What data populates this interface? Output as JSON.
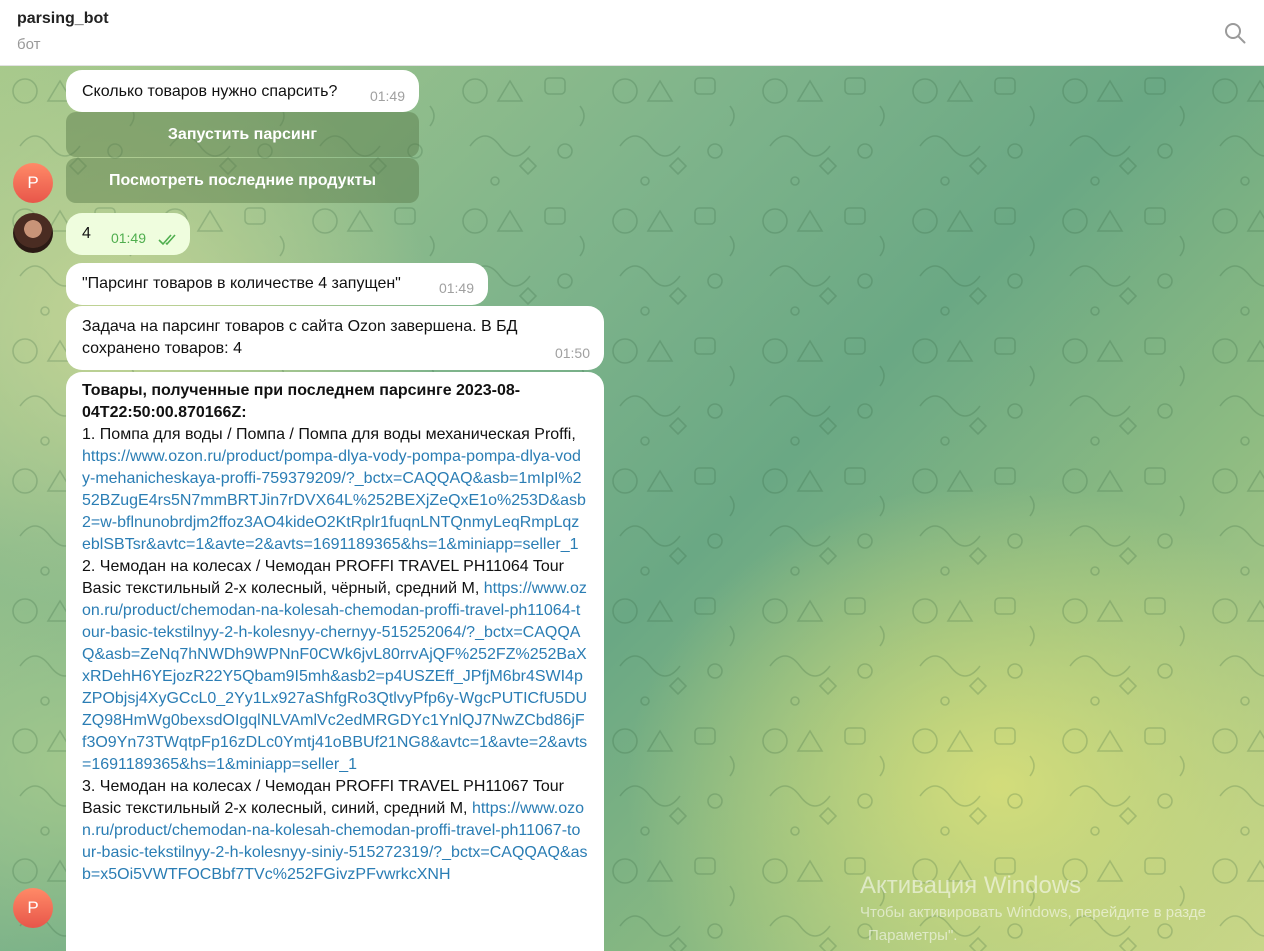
{
  "header": {
    "title": "parsing_bot",
    "subtitle": "бот"
  },
  "messages": {
    "m1": {
      "text": "Сколько товаров нужно спарсить?",
      "time": "01:49"
    },
    "m2": {
      "text": "4",
      "time": "01:49"
    },
    "m3": {
      "text": "\"Парсинг товаров в количестве 4 запущен\"",
      "time": "01:49"
    },
    "m4": {
      "text": "Задача на парсинг товаров с сайта Ozon завершена. В БД сохранено товаров: 4",
      "time": "01:50"
    }
  },
  "keyboard": {
    "btn1": "Запустить парсинг",
    "btn2": "Посмотреть последние продукты"
  },
  "avatar": {
    "bot_letter": "P"
  },
  "products": {
    "heading": "Товары, полученные при последнем парсинге 2023-08-04T22:50:00.870166Z:",
    "items": [
      {
        "title": "1. Помпа для воды / Помпа / Помпа для воды механическая Proffi,",
        "url": "https://www.ozon.ru/product/pompa-dlya-vody-pompa-pompa-dlya-vody-mehanicheskaya-proffi-759379209/?_bctx=CAQQAQ&asb=1mIpI%252BZugE4rs5N7mmBRTJin7rDVX64L%252BEXjZeQxE1o%253D&asb2=w-bflnunobrdjm2ffoz3AO4kideO2KtRplr1fuqnLNTQnmyLeqRmpLqzeblSBTsr&avtc=1&avte=2&avts=1691189365&hs=1&miniapp=seller_1"
      },
      {
        "title": "2. Чемодан на колесах / Чемодан PROFFI TRAVEL PH11064 Tour Basic текстильный 2-х колесный, чёрный, средний M,",
        "url": "https://www.ozon.ru/product/chemodan-na-kolesah-chemodan-proffi-travel-ph11064-tour-basic-tekstilnyy-2-h-kolesnyy-chernyy-515252064/?_bctx=CAQQAQ&asb=ZeNq7hNWDh9WPNnF0CWk6jvL80rrvAjQF%252FZ%252BaXxRDehH6YEjozR22Y5Qbam9I5mh&asb2=p4USZEff_JPfjM6br4SWI4pZPObjsj4XyGCcL0_2Yy1Lx927aShfgRo3QtlvyPfp6y-WgcPUTICfU5DUZQ98HmWg0bexsdOIgqlNLVAmlVc2edMRGDYc1YnlQJ7NwZCbd86jFf3O9Yn73TWqtpFp16zDLc0Ymtj41oBBUf21NG8&avtc=1&avte=2&avts=1691189365&hs=1&miniapp=seller_1"
      },
      {
        "title": "3. Чемодан на колесах / Чемодан PROFFI TRAVEL PH11067 Tour Basic текстильный 2-х колесный, синий, средний M,",
        "url": "https://www.ozon.ru/product/chemodan-na-kolesah-chemodan-proffi-travel-ph11067-tour-basic-tekstilnyy-2-h-kolesnyy-siniy-515272319/?_bctx=CAQQAQ&asb=x5Oi5VWTFOCBbf7TVc%252FGivzPFvwrkcXNH"
      }
    ]
  },
  "watermark": {
    "line1": "Активация Windows",
    "line2": "Чтобы активировать Windows, перейдите в разде",
    "line3": "Параметры\"."
  }
}
